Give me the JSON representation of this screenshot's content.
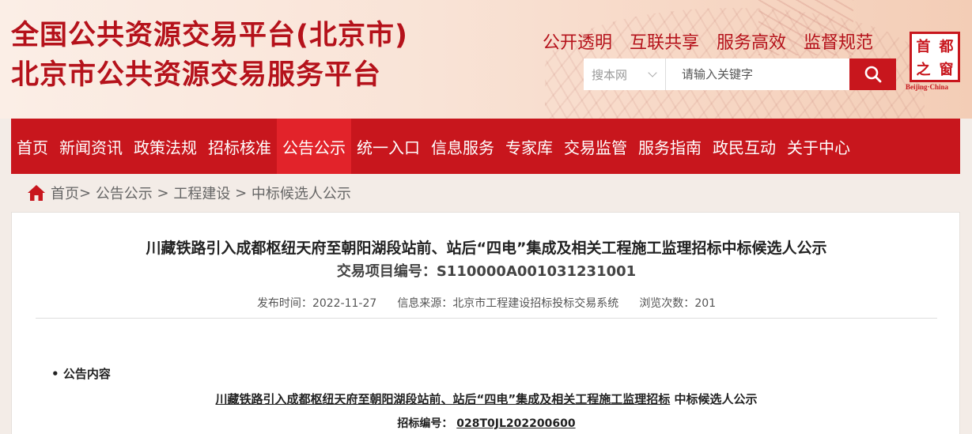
{
  "header": {
    "title_line1": "全国公共资源交易平台(北京市)",
    "title_line2": "北京市公共资源交易服务平台",
    "slogans": [
      "公开透明",
      "互联共享",
      "服务高效",
      "监督规范"
    ],
    "logo": {
      "chars": [
        "首",
        "都",
        "之",
        "窗"
      ],
      "en": "Beijing·China"
    },
    "search": {
      "scope": "搜本网",
      "placeholder": "请输入关键字"
    }
  },
  "nav": {
    "items": [
      "首页",
      "新闻资讯",
      "政策法规",
      "招标核准",
      "公告公示",
      "统一入口",
      "信息服务",
      "专家库",
      "交易监管",
      "服务指南",
      "政民互动",
      "关于中心"
    ],
    "active": "公告公示"
  },
  "breadcrumb": [
    "首页",
    "公告公示",
    "工程建设",
    "中标候选人公示"
  ],
  "article": {
    "title": "川藏铁路引入成都枢纽天府至朝阳湖段站前、站后“四电”集成及相关工程施工监理招标中标候选人公示",
    "project_no_label": "交易项目编号：",
    "project_no": "S110000A001031231001",
    "publish_label": "发布时间：",
    "publish_date": "2022-11-27",
    "source_label": "信息来源：",
    "source": "北京市工程建设招标投标交易系统",
    "views_label": "浏览次数：",
    "views": "201",
    "section_label": "公告内容",
    "doc_title_underlined": "川藏铁路引入成都枢纽天府至朝阳湖段站前、站后“四电”集成及相关工程施工监理招标",
    "doc_title_suffix": "中标候选人公示",
    "bid_no_label": "招标编号：",
    "bid_no": "028T0JL202200600"
  },
  "colors": {
    "brand_red": "#c8161d",
    "active_nav": "#e2232a"
  }
}
